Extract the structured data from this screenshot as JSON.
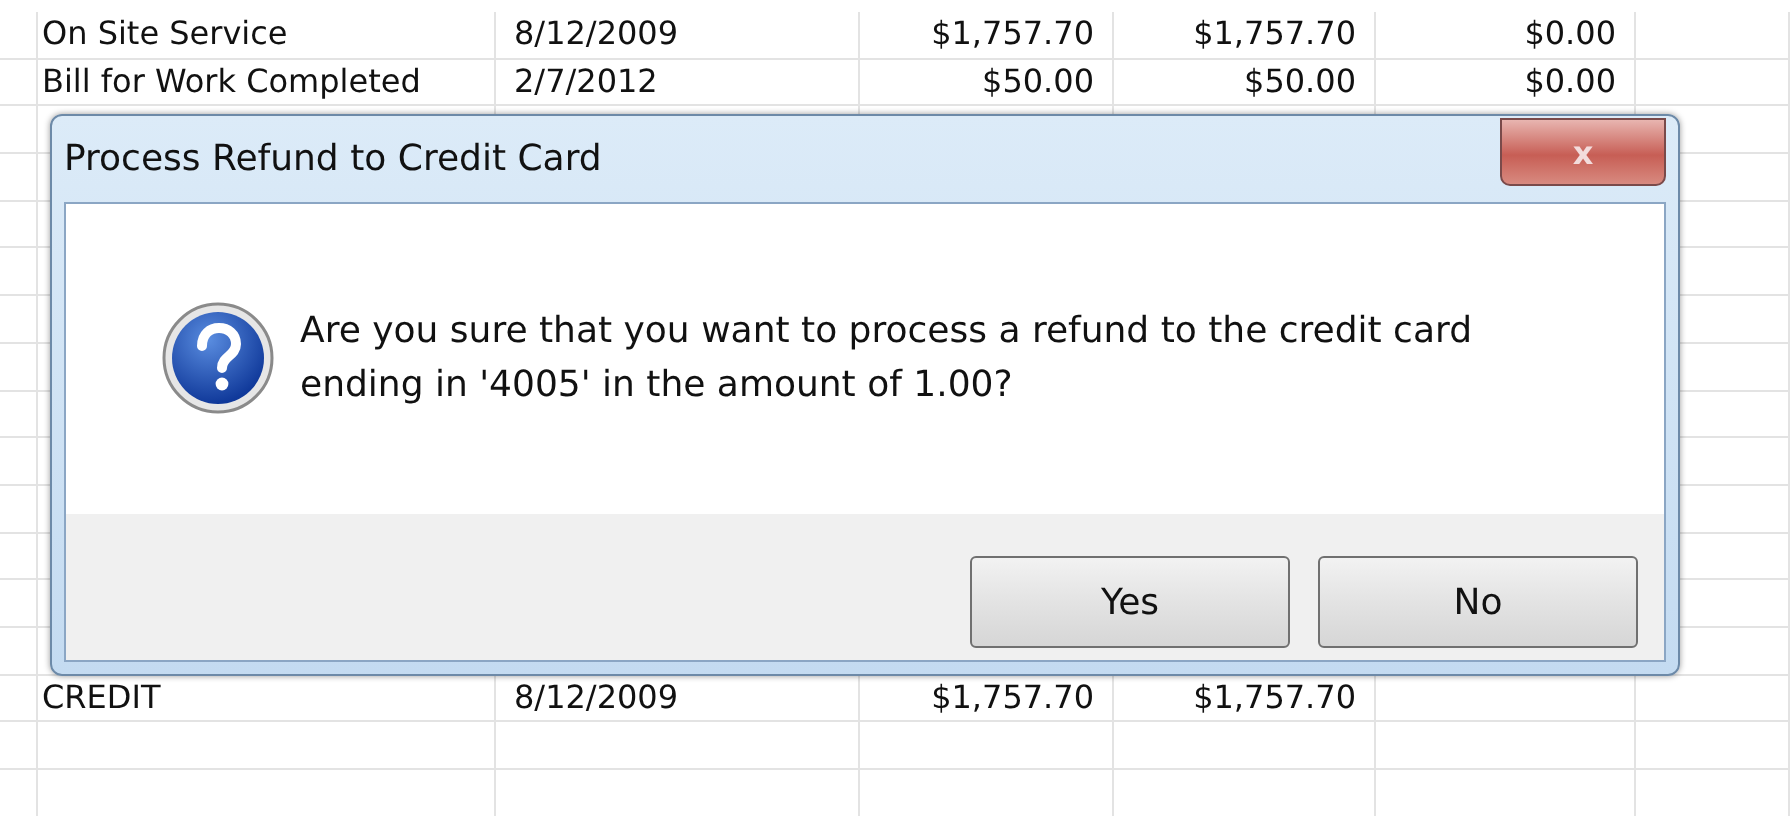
{
  "sheet": {
    "rows": [
      {
        "cells": [
          "On Site Service",
          "8/12/2009",
          "$1,757.70",
          "$1,757.70",
          "$0.00"
        ]
      },
      {
        "cells": [
          "Bill for Work Completed",
          "2/7/2012",
          "$50.00",
          "$50.00",
          "$0.00"
        ]
      },
      {
        "cells": []
      },
      {
        "cells": []
      },
      {
        "cells": []
      },
      {
        "cells": []
      },
      {
        "cells": []
      },
      {
        "cells": []
      },
      {
        "cells": []
      },
      {
        "cells": []
      },
      {
        "cells": []
      },
      {
        "cells": []
      },
      {
        "cells": []
      },
      {
        "cells": []
      },
      {
        "cells": [
          "CREDIT",
          "8/12/2009",
          "$1,757.70",
          "$1,757.70"
        ]
      },
      {
        "cells": []
      },
      {
        "cells": []
      }
    ]
  },
  "dialog": {
    "title": "Process Refund to Credit Card",
    "close": "x",
    "message": "Are you sure that you want to process a refund to the credit card ending in '4005' in the amount of 1.00?",
    "buttons": [
      "Yes",
      "No"
    ]
  }
}
